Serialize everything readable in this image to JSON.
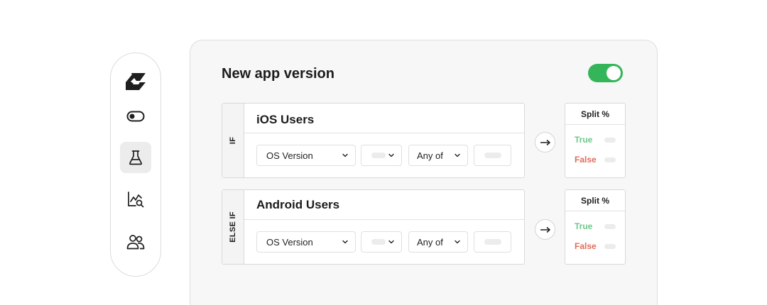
{
  "sidebar": {
    "items": [
      {
        "icon": "logo-icon"
      },
      {
        "icon": "toggle-icon"
      },
      {
        "icon": "flask-icon",
        "active": true
      },
      {
        "icon": "chart-search-icon"
      },
      {
        "icon": "users-icon"
      }
    ]
  },
  "panel": {
    "title": "New app version",
    "enabled": true,
    "accent_color": "#34b55a"
  },
  "conditions": [
    {
      "tag": "IF",
      "name": "iOS Users",
      "attribute": "OS Version",
      "operator": "Any of",
      "split": {
        "header": "Split %",
        "true_label": "True",
        "false_label": "False"
      }
    },
    {
      "tag": "ELSE IF",
      "name": "Android Users",
      "attribute": "OS Version",
      "operator": "Any of",
      "split": {
        "header": "Split %",
        "true_label": "True",
        "false_label": "False"
      }
    }
  ],
  "colors": {
    "true": "#6cc88a",
    "false": "#e26c5a"
  }
}
